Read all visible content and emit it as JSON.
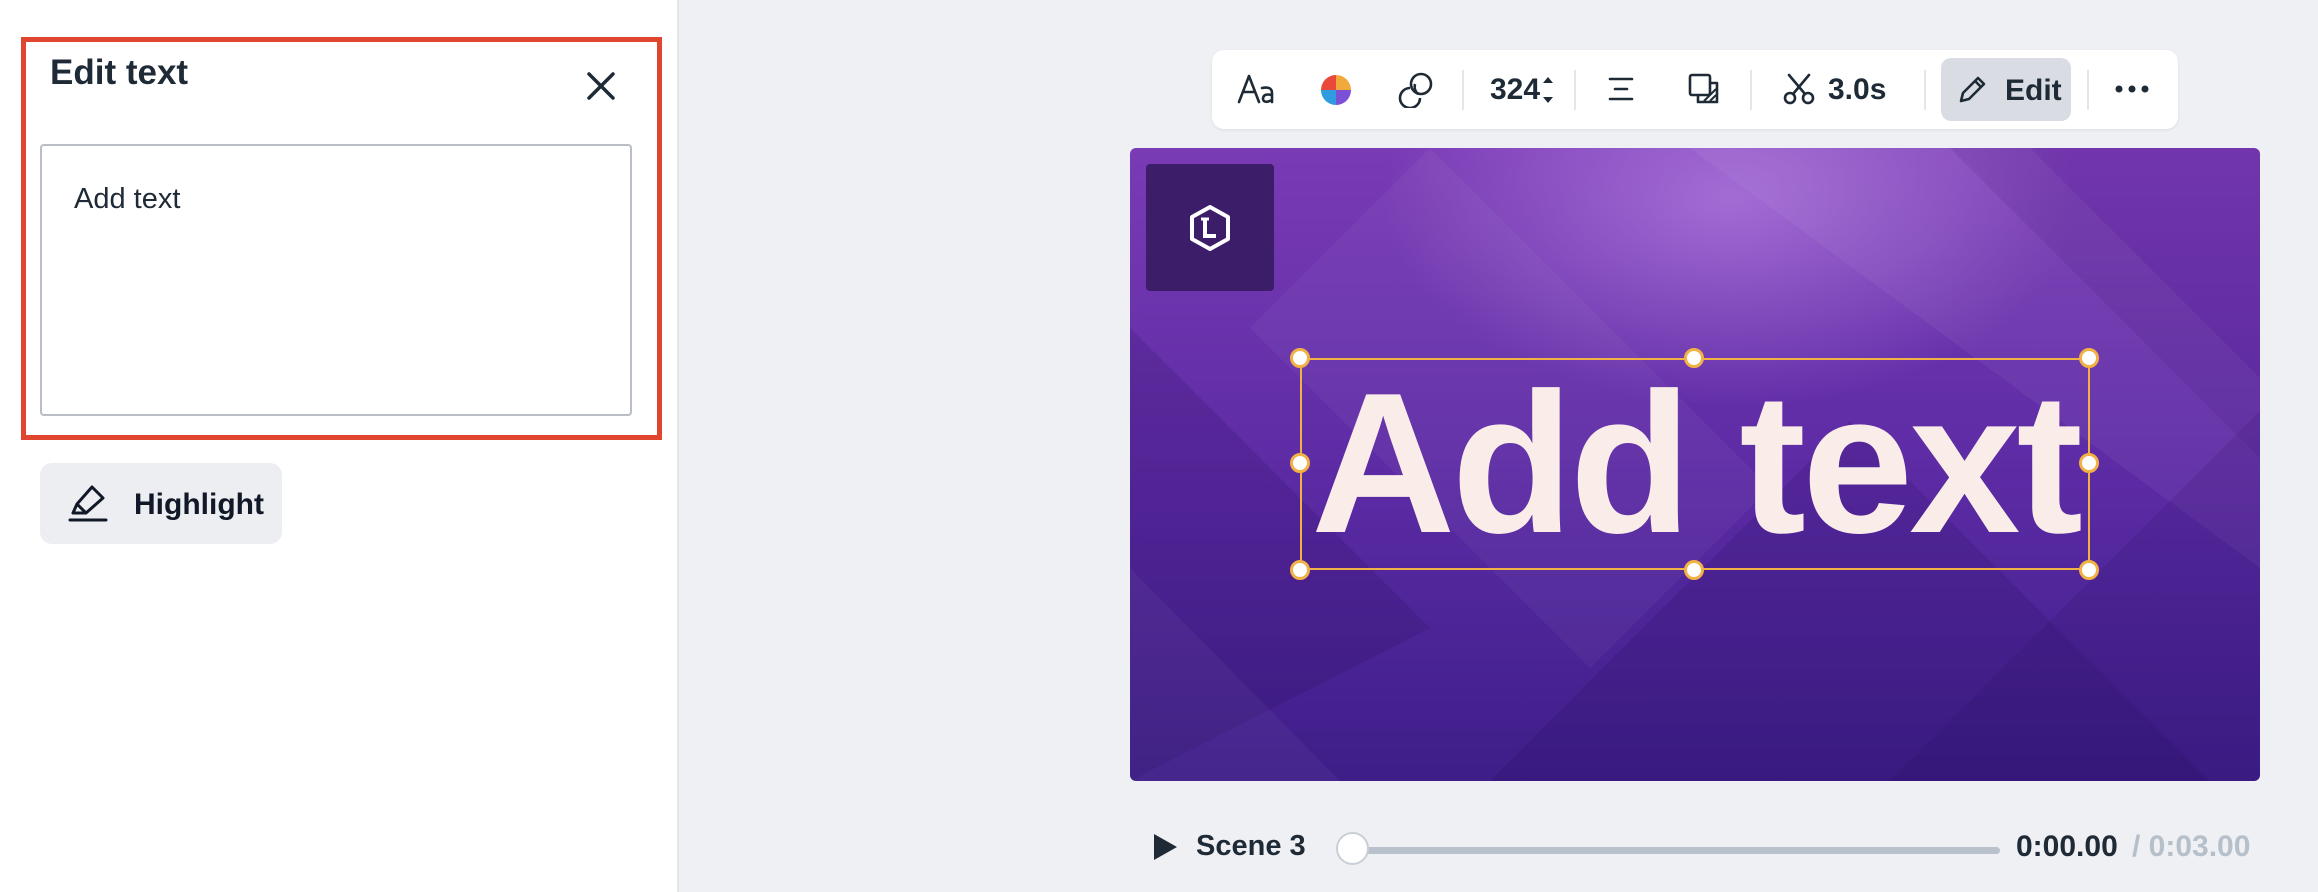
{
  "panel": {
    "title": "Edit text",
    "text_value": "Add text",
    "highlight_label": "Highlight"
  },
  "toolbar": {
    "font_size": "324",
    "duration": "3.0s",
    "edit_label": "Edit"
  },
  "canvas": {
    "text": "Add text"
  },
  "playback": {
    "scene_label": "Scene 3",
    "current_time": "0:00.00",
    "total_time": "/ 0:03.00",
    "progress": 0
  },
  "colors": {
    "accent_border": "#e0452f",
    "selection": "#f2b144",
    "canvas_bg": "#5a2aa3",
    "text_color": "#faede9"
  },
  "icons": {
    "close": "close-icon",
    "highlight": "highlighter-icon",
    "font": "font-icon",
    "color": "color-wheel-icon",
    "effects": "effects-icon",
    "align": "align-icon",
    "layer": "layer-icon",
    "trim": "scissors-icon",
    "edit": "pencil-icon",
    "more": "more-icon",
    "play": "play-icon",
    "logo": "logo-icon"
  }
}
